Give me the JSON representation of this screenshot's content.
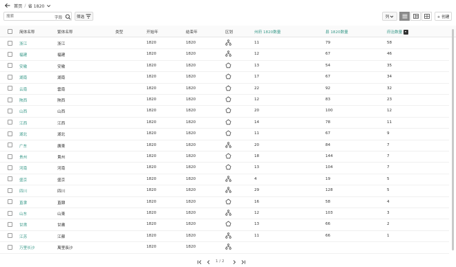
{
  "breadcrumb": {
    "home": "首页",
    "separator": "/",
    "current": "省 1820"
  },
  "toolbar": {
    "search_placeholder": "搜索",
    "field_label": "字段",
    "filter_label": "筛选",
    "columns_label": "列",
    "create_label": "+ 创建"
  },
  "table": {
    "headers": {
      "simplified": "简体名称",
      "traditional": "繁体名称",
      "type": "类型",
      "start_year": "开始年",
      "end_year": "结束年",
      "region": "区划",
      "prefecture_count": "州府 1820数量",
      "county_count": "县 1820数量",
      "seat_count": "府治数量"
    },
    "rows": [
      {
        "simp": "浙江",
        "trad": "浙江",
        "start": "1820",
        "end": "1820",
        "icon": "tree",
        "pref": "11",
        "county": "79",
        "seat": "58"
      },
      {
        "simp": "福建",
        "trad": "福建",
        "start": "1820",
        "end": "1820",
        "icon": "tree",
        "pref": "12",
        "county": "67",
        "seat": "46"
      },
      {
        "simp": "安徽",
        "trad": "安徽",
        "start": "1820",
        "end": "1820",
        "icon": "pentagon",
        "pref": "13",
        "county": "54",
        "seat": "35"
      },
      {
        "simp": "湖南",
        "trad": "湖南",
        "start": "1820",
        "end": "1820",
        "icon": "pentagon",
        "pref": "17",
        "county": "67",
        "seat": "34"
      },
      {
        "simp": "云南",
        "trad": "雲南",
        "start": "1820",
        "end": "1820",
        "icon": "pentagon",
        "pref": "22",
        "county": "92",
        "seat": "32"
      },
      {
        "simp": "陕西",
        "trad": "陝西",
        "start": "1820",
        "end": "1820",
        "icon": "pentagon",
        "pref": "12",
        "county": "83",
        "seat": "23"
      },
      {
        "simp": "山西",
        "trad": "山西",
        "start": "1820",
        "end": "1820",
        "icon": "pentagon",
        "pref": "20",
        "county": "100",
        "seat": "12"
      },
      {
        "simp": "江西",
        "trad": "江西",
        "start": "1820",
        "end": "1820",
        "icon": "pentagon",
        "pref": "14",
        "county": "78",
        "seat": "11"
      },
      {
        "simp": "湖北",
        "trad": "湖北",
        "start": "1820",
        "end": "1820",
        "icon": "pentagon",
        "pref": "11",
        "county": "67",
        "seat": "9"
      },
      {
        "simp": "广东",
        "trad": "廣東",
        "start": "1820",
        "end": "1820",
        "icon": "tree",
        "pref": "20",
        "county": "84",
        "seat": "7"
      },
      {
        "simp": "贵州",
        "trad": "貴州",
        "start": "1820",
        "end": "1820",
        "icon": "pentagon",
        "pref": "18",
        "county": "144",
        "seat": "7"
      },
      {
        "simp": "河南",
        "trad": "河南",
        "start": "1820",
        "end": "1820",
        "icon": "pentagon",
        "pref": "13",
        "county": "104",
        "seat": "7"
      },
      {
        "simp": "盛京",
        "trad": "盛京",
        "start": "1820",
        "end": "1820",
        "icon": "tree",
        "pref": "4",
        "county": "19",
        "seat": "5"
      },
      {
        "simp": "四川",
        "trad": "四川",
        "start": "1820",
        "end": "1820",
        "icon": "tree",
        "pref": "29",
        "county": "128",
        "seat": "5"
      },
      {
        "simp": "直隶",
        "trad": "直隸",
        "start": "1820",
        "end": "1820",
        "icon": "pentagon",
        "pref": "16",
        "county": "58",
        "seat": "4"
      },
      {
        "simp": "山东",
        "trad": "山東",
        "start": "1820",
        "end": "1820",
        "icon": "tree",
        "pref": "12",
        "county": "103",
        "seat": "3"
      },
      {
        "simp": "甘肃",
        "trad": "甘肅",
        "start": "1820",
        "end": "1820",
        "icon": "pentagon",
        "pref": "13",
        "county": "66",
        "seat": "2"
      },
      {
        "simp": "江苏",
        "trad": "江蘇",
        "start": "1820",
        "end": "1820",
        "icon": "tree",
        "pref": "11",
        "county": "66",
        "seat": "1"
      },
      {
        "simp": "万里长沙",
        "trad": "萬里長沙",
        "start": "1820",
        "end": "1820",
        "icon": "tree",
        "pref": "",
        "county": "",
        "seat": ""
      }
    ]
  },
  "pager": {
    "info": "1 / 2"
  },
  "colors": {
    "accent": "#3a9a8a",
    "active_view": "#8a8a8a"
  }
}
